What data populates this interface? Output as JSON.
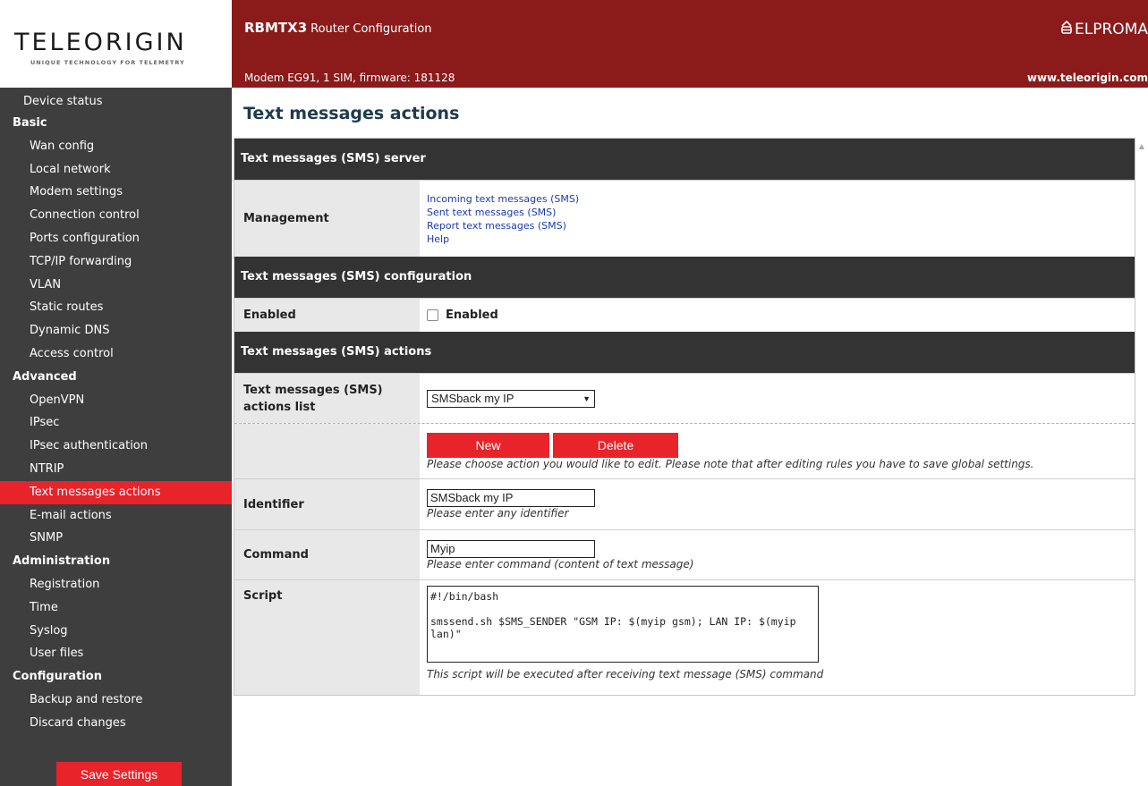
{
  "logo": {
    "name": "TELEORIGIN",
    "tagline": "UNIQUE TECHNOLOGY FOR TELEMETRY"
  },
  "header": {
    "title": "RBMTX3",
    "subtitle": "Router Configuration",
    "brand": "ELPROMA",
    "modem": "Modem EG91, 1 SIM, firmware: 181128",
    "url": "www.teleorigin.com"
  },
  "sidebar": {
    "device_status": "Device status",
    "basic": {
      "label": "Basic",
      "items": [
        "Wan config",
        "Local network",
        "Modem settings",
        "Connection control",
        "Ports configuration",
        "TCP/IP forwarding",
        "VLAN",
        "Static routes",
        "Dynamic DNS",
        "Access control"
      ]
    },
    "advanced": {
      "label": "Advanced",
      "items": [
        "OpenVPN",
        "IPsec",
        "IPsec authentication",
        "NTRIP",
        "Text messages actions",
        "E-mail actions",
        "SNMP"
      ]
    },
    "administration": {
      "label": "Administration",
      "items": [
        "Registration",
        "Time",
        "Syslog",
        "User files"
      ]
    },
    "configuration": {
      "label": "Configuration",
      "items": [
        "Backup and restore",
        "Discard changes"
      ]
    },
    "save_button": "Save Settings"
  },
  "page": {
    "title": "Text messages actions",
    "server_section": {
      "header": "Text messages (SMS) server",
      "management_label": "Management",
      "links": [
        "Incoming text messages (SMS)",
        "Sent text messages (SMS)",
        "Report text messages (SMS)",
        "Help"
      ]
    },
    "config_section": {
      "header": "Text messages (SMS) configuration",
      "enabled_label": "Enabled",
      "enabled_checkbox_label": "Enabled",
      "enabled": false
    },
    "actions_section": {
      "header": "Text messages (SMS) actions",
      "list_label": "Text messages (SMS) actions list",
      "list_selected": "SMSback my IP",
      "new_button": "New",
      "delete_button": "Delete",
      "actions_hint": "Please choose action you would like to edit. Please note that after editing rules you have to save global settings.",
      "identifier_label": "Identifier",
      "identifier_value": "SMSback my IP",
      "identifier_hint": "Please enter any identifier",
      "command_label": "Command",
      "command_value": "Myip",
      "command_hint": "Please enter command (content of text message)",
      "script_label": "Script",
      "script_value": "#!/bin/bash\n\nsmssend.sh $SMS_SENDER \"GSM IP: $(myip gsm); LAN IP: $(myip lan)\"",
      "script_hint": "This script will be executed after receiving text message (SMS) command"
    }
  },
  "colors": {
    "header_bg": "#8b1a1b",
    "sidebar_bg": "#3e3e3e",
    "accent_red": "#e8232a",
    "section_header_bg": "#333333",
    "label_bg": "#e8e8e8",
    "title_color": "#1f3a4f"
  },
  "icons": [
    "dropdown-arrow-icon",
    "elproma-logo-icon",
    "scroll-up-arrow-icon"
  ]
}
